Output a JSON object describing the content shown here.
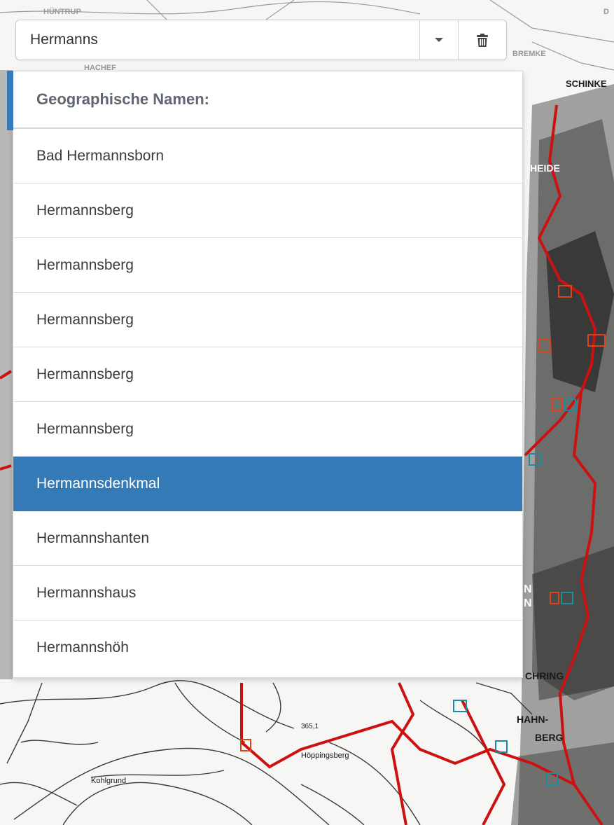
{
  "map": {
    "labels": [
      "HÜNTRUP",
      "HACHEF",
      "SCHINKE",
      "BREMKE",
      "HEIDE",
      "HAHN-",
      "BERG",
      "Kohlgrund",
      "Höppingsberg",
      "365,1",
      "CHRING",
      "N",
      "N",
      "D"
    ]
  },
  "search": {
    "value": "Hermanns",
    "dropdown_icon": "caret-down-icon",
    "delete_icon": "trash-icon"
  },
  "dropdown": {
    "header": "Geographische Namen:",
    "items": [
      {
        "label": "Bad Hermannsborn",
        "selected": false
      },
      {
        "label": "Hermannsberg",
        "selected": false
      },
      {
        "label": "Hermannsberg",
        "selected": false
      },
      {
        "label": "Hermannsberg",
        "selected": false
      },
      {
        "label": "Hermannsberg",
        "selected": false
      },
      {
        "label": "Hermannsberg",
        "selected": false
      },
      {
        "label": "Hermannsdenkmal",
        "selected": true
      },
      {
        "label": "Hermannshanten",
        "selected": false
      },
      {
        "label": "Hermannshaus",
        "selected": false
      },
      {
        "label": "Hermannshöh",
        "selected": false
      }
    ],
    "colors": {
      "accent": "#337ab7",
      "route": "#cc1111",
      "poi_red": "#d9451b",
      "poi_teal": "#1b8ca0"
    }
  }
}
